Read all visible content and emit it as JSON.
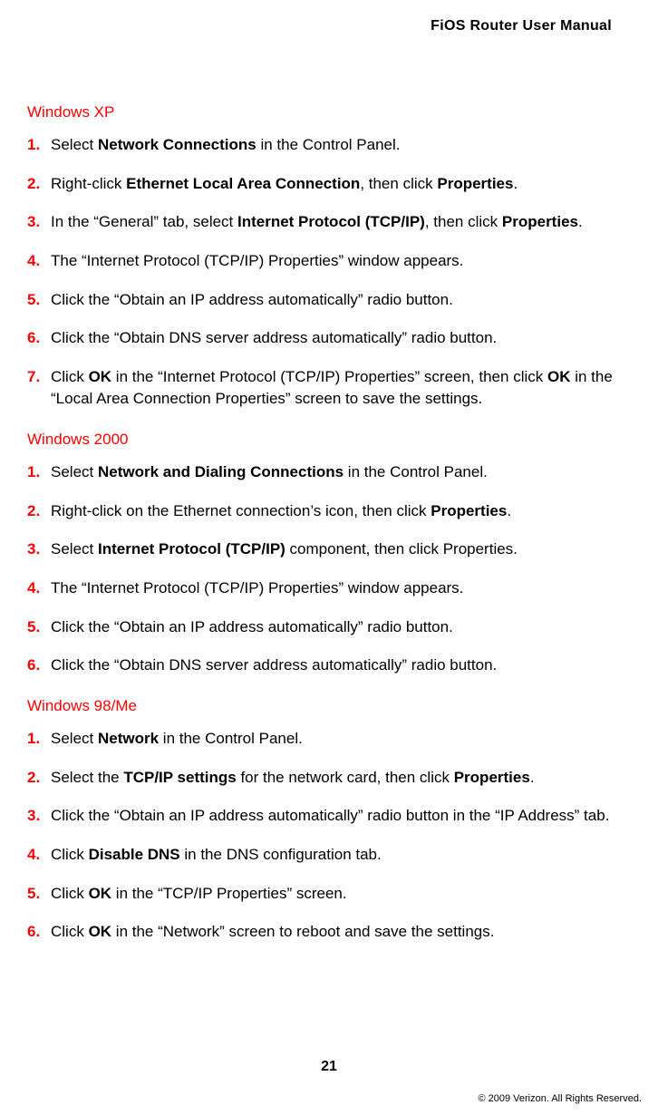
{
  "header": {
    "title": "FiOS Router User Manual"
  },
  "sections": [
    {
      "heading": "Windows XP",
      "items": [
        {
          "num": "1.",
          "html": "Select <b>Network Connections</b> in the Control Panel."
        },
        {
          "num": "2.",
          "html": "Right-click <b>Ethernet Local Area Connection</b>, then click <b>Properties</b>."
        },
        {
          "num": "3.",
          "html": "In the “General” tab, select <b>Internet Protocol (TCP/IP)</b>, then click <b>Properties</b>."
        },
        {
          "num": "4.",
          "html": "The “Internet Protocol (TCP/IP) Properties” window appears."
        },
        {
          "num": "5.",
          "html": "Click the “Obtain an IP address automatically” radio button."
        },
        {
          "num": "6.",
          "html": "Click the “Obtain DNS server address automatically” radio button."
        },
        {
          "num": "7.",
          "html": "Click <b>OK</b> in the “Internet Protocol (TCP/IP) Properties” screen, then click <b>OK</b> in the “Local Area Connection Properties” screen to save the settings."
        }
      ]
    },
    {
      "heading": "Windows 2000",
      "items": [
        {
          "num": "1.",
          "html": "Select <b>Network and Dialing Connections</b> in the Control Panel."
        },
        {
          "num": "2.",
          "html": "Right-click on the Ethernet connection’s icon, then click <b>Properties</b>."
        },
        {
          "num": "3.",
          "html": "Select <b>Internet Protocol (TCP/IP)</b> component, then click Properties."
        },
        {
          "num": "4.",
          "html": "The “Internet Protocol (TCP/IP) Properties” window appears."
        },
        {
          "num": "5.",
          "html": "Click the “Obtain an IP address automatically” radio button."
        },
        {
          "num": "6.",
          "html": "Click the “Obtain DNS server address automatically” radio button."
        }
      ]
    },
    {
      "heading": "Windows 98/Me",
      "items": [
        {
          "num": "1.",
          "html": "Select <b>Network</b> in the Control Panel."
        },
        {
          "num": "2.",
          "html": "Select the <b>TCP/IP settings</b> for the network card, then click <b>Properties</b>."
        },
        {
          "num": "3.",
          "html": "Click the “Obtain an IP address automatically” radio button in the “IP Address” tab."
        },
        {
          "num": "4.",
          "html": "Click <b>Disable DNS</b> in the DNS configuration tab."
        },
        {
          "num": "5.",
          "html": "Click <b>OK</b> in the “TCP/IP Properties” screen."
        },
        {
          "num": "6.",
          "html": "Click <b>OK</b> in the “Network” screen to reboot and save the settings."
        }
      ]
    }
  ],
  "footer": {
    "page_number": "21",
    "copyright": "© 2009 Verizon. All Rights Reserved."
  }
}
